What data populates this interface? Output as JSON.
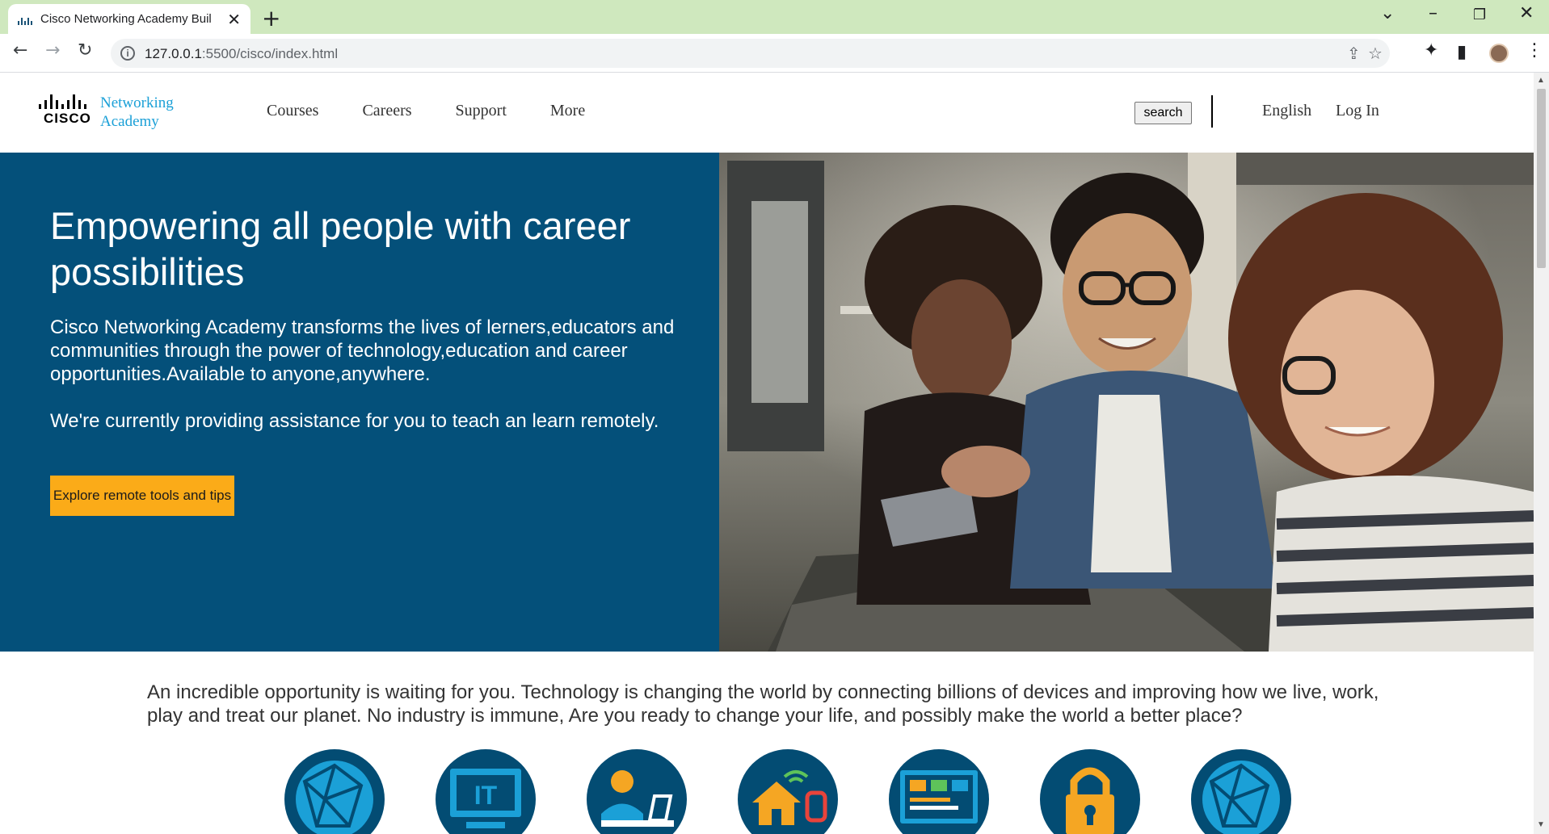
{
  "browser": {
    "tab_title": "Cisco Networking Academy Buil",
    "url_host": "127.0.0.1",
    "url_path": ":5500/cisco/index.html",
    "close_glyph": "✕",
    "new_tab_glyph": "+"
  },
  "header": {
    "logo_word": "CISCO",
    "logo_line1": "Networking",
    "logo_line2": "Academy",
    "nav": [
      "Courses",
      "Careers",
      "Support",
      "More"
    ],
    "search_label": "search",
    "language": "English",
    "login": "Log In"
  },
  "hero": {
    "title": "Empowering all people with career possibilities",
    "text": "Cisco Networking Academy transforms the lives of lerners,educators and communities through the power of technology,education and career opportunities.Available to anyone,anywhere.",
    "text2": "We're currently providing assistance for you to teach an learn remotely.",
    "cta": "Explore remote tools and tips"
  },
  "intro": {
    "text": "An incredible opportunity is waiting for you. Technology is changing the world by connecting billions of devices and improving how we live, work, play and treat our planet. No industry is immune, Are you ready to change your life, and possibly make the world a better place?"
  },
  "icons": [
    "globe-network-icon",
    "it-monitor-icon",
    "person-laptop-icon",
    "smart-home-icon",
    "code-screen-icon",
    "padlock-icon",
    "globe-network-icon"
  ],
  "colors": {
    "hero_bg": "#04507a",
    "cta_bg": "#fbab18",
    "logo_blue": "#1ba0d7",
    "icon_circle": "#034c73",
    "icon_light": "#1ba0d7",
    "chrome_bar": "#cfe8be"
  }
}
